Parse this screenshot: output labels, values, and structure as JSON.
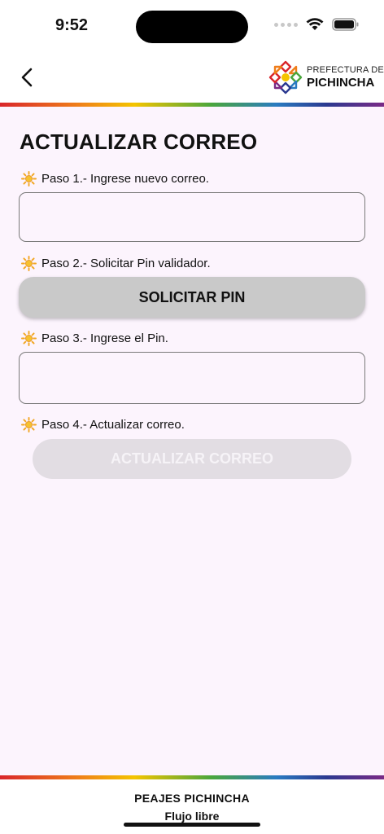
{
  "status_bar": {
    "time": "9:52"
  },
  "header": {
    "logo": {
      "line1": "PREFECTURA DE",
      "line2": "PICHINCHA"
    }
  },
  "main": {
    "title": "ACTUALIZAR CORREO",
    "steps": [
      {
        "label": "Paso 1.- Ingrese nuevo correo."
      },
      {
        "label": "Paso 2.- Solicitar Pin validador."
      },
      {
        "label": "Paso 3.- Ingrese el Pin."
      },
      {
        "label": "Paso 4.- Actualizar correo."
      }
    ],
    "email_input": {
      "value": "",
      "placeholder": ""
    },
    "pin_input": {
      "value": "",
      "placeholder": ""
    },
    "request_pin_label": "SOLICITAR PIN",
    "update_email_label": "ACTUALIZAR CORREO"
  },
  "footer": {
    "title": "PEAJES PICHINCHA",
    "subtitle": "Flujo libre"
  },
  "colors": {
    "background": "#fcf4fd",
    "button": "#c9c9c9",
    "button_disabled": "#e2dde3",
    "step_icon": "#f2a623"
  }
}
